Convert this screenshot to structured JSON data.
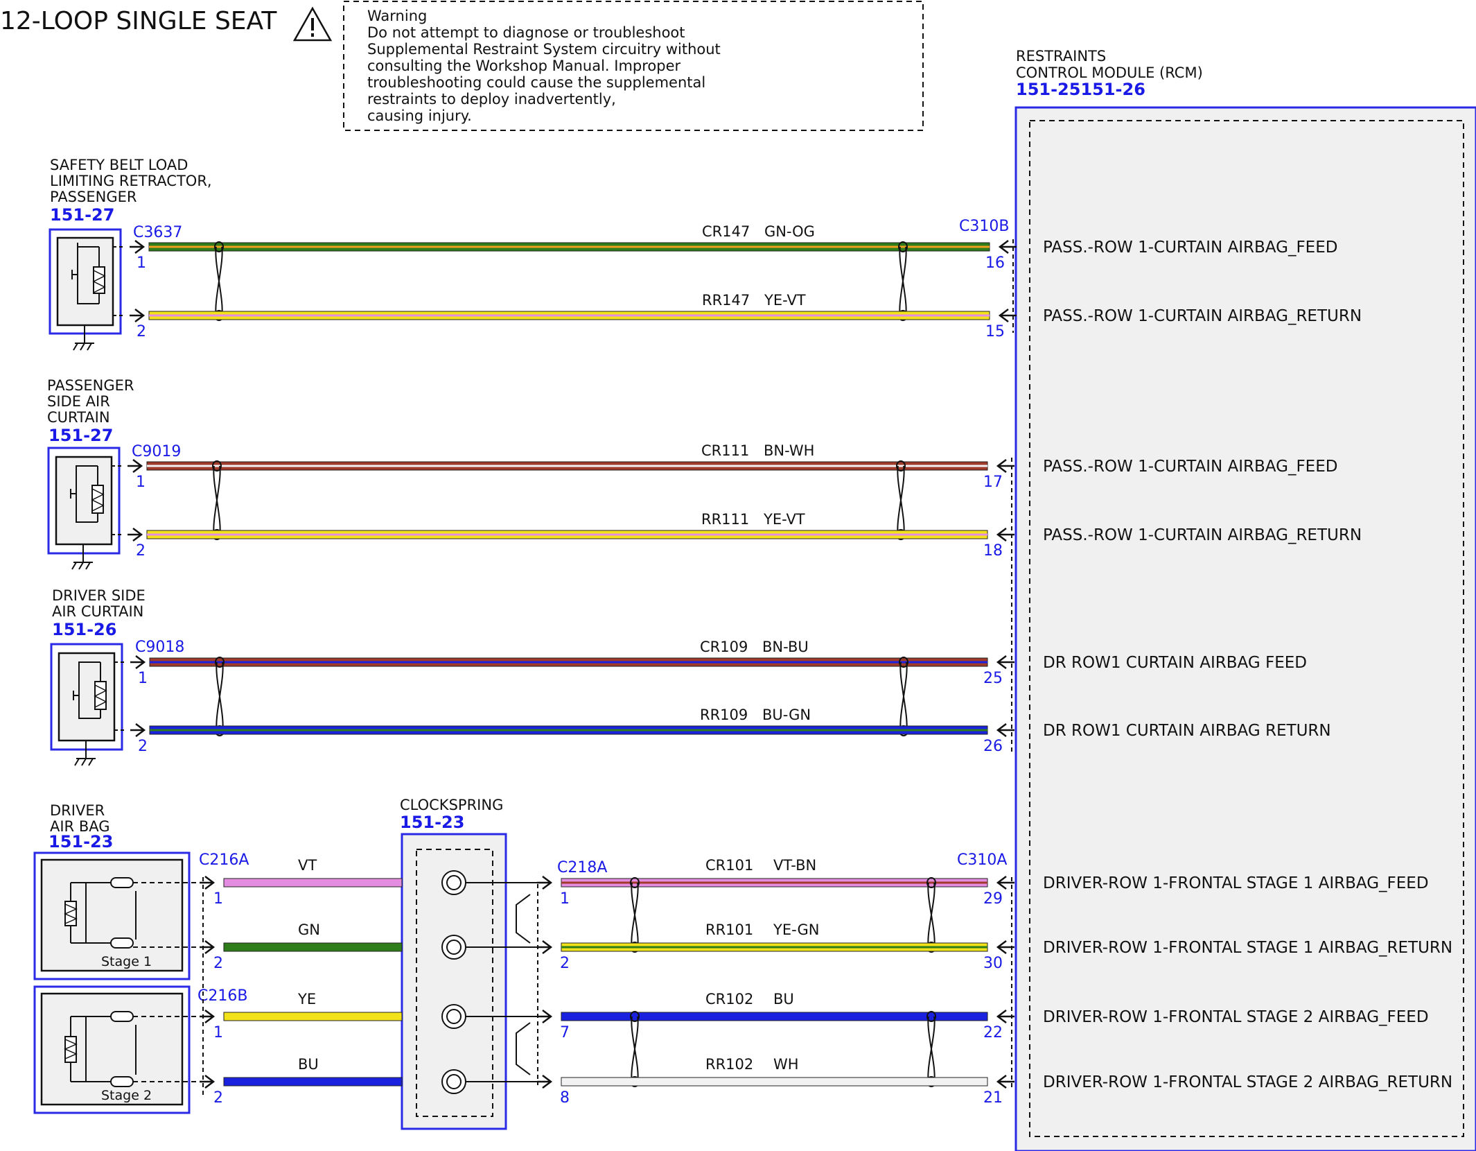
{
  "title": "12-LOOP SINGLE SEAT",
  "warning": {
    "heading": "Warning",
    "lines": [
      "Do not attempt to diagnose or troubleshoot",
      "Supplemental Restraint System circuitry without",
      "consulting the Workshop Manual. Improper",
      "troubleshooting could cause the supplemental",
      "restraints to deploy inadvertently,",
      "causing injury."
    ]
  },
  "rcm": {
    "name_lines": [
      "RESTRAINTS",
      "CONTROL MODULE (RCM)"
    ],
    "ref": "151-25151-26",
    "connector_upper": "C310B",
    "connector_lower": "C310A"
  },
  "components": [
    {
      "name_lines": [
        "SAFETY BELT LOAD",
        "LIMITING RETRACTOR,",
        "PASSENGER"
      ],
      "ref": "151-27",
      "connector": "C3637"
    },
    {
      "name_lines": [
        "PASSENGER",
        "SIDE AIR",
        "CURTAIN"
      ],
      "ref": "151-27",
      "connector": "C9019"
    },
    {
      "name_lines": [
        "DRIVER SIDE",
        "AIR CURTAIN"
      ],
      "ref": "151-26",
      "connector": "C9018"
    }
  ],
  "driver_airbag": {
    "name_lines": [
      "DRIVER",
      "AIR BAG"
    ],
    "ref": "151-23",
    "stage1_label": "Stage 1",
    "stage2_label": "Stage 2",
    "connector_1": "C216A",
    "connector_2": "C216B"
  },
  "clockspring": {
    "name": "CLOCKSPRING",
    "ref": "151-23",
    "connector_out": "C218A"
  },
  "circuits": [
    {
      "circuit": "CR147",
      "color": "GN-OG",
      "pin_left": "1",
      "pin_right": "16",
      "signal": "PASS.-ROW 1-CURTAIN AIRBAG_FEED"
    },
    {
      "circuit": "RR147",
      "color": "YE-VT",
      "pin_left": "2",
      "pin_right": "15",
      "signal": "PASS.-ROW 1-CURTAIN AIRBAG_RETURN"
    },
    {
      "circuit": "CR111",
      "color": "BN-WH",
      "pin_left": "1",
      "pin_right": "17",
      "signal": "PASS.-ROW 1-CURTAIN AIRBAG_FEED"
    },
    {
      "circuit": "RR111",
      "color": "YE-VT",
      "pin_left": "2",
      "pin_right": "18",
      "signal": "PASS.-ROW 1-CURTAIN AIRBAG_RETURN"
    },
    {
      "circuit": "CR109",
      "color": "BN-BU",
      "pin_left": "1",
      "pin_right": "25",
      "signal": "DR ROW1 CURTAIN AIRBAG FEED"
    },
    {
      "circuit": "RR109",
      "color": "BU-GN",
      "pin_left": "2",
      "pin_right": "26",
      "signal": "DR ROW1 CURTAIN AIRBAG RETURN"
    },
    {
      "circuit": "CR101",
      "color": "VT-BN",
      "pin_left": "1",
      "pin_right": "29",
      "signal": "DRIVER-ROW 1-FRONTAL STAGE 1 AIRBAG_FEED",
      "airbag_wire": "VT",
      "airbag_pin": "1"
    },
    {
      "circuit": "RR101",
      "color": "YE-GN",
      "pin_left": "2",
      "pin_right": "30",
      "signal": "DRIVER-ROW 1-FRONTAL STAGE 1 AIRBAG_RETURN",
      "airbag_wire": "GN",
      "airbag_pin": "2"
    },
    {
      "circuit": "CR102",
      "color": "BU",
      "pin_left": "7",
      "pin_right": "22",
      "signal": "DRIVER-ROW 1-FRONTAL STAGE 2 AIRBAG_FEED",
      "airbag_wire": "YE",
      "airbag_pin": "1"
    },
    {
      "circuit": "RR102",
      "color": "WH",
      "pin_left": "8",
      "pin_right": "21",
      "signal": "DRIVER-ROW 1-FRONTAL STAGE 2 AIRBAG_RETURN",
      "airbag_wire": "BU",
      "airbag_pin": "2"
    }
  ],
  "wire_colors": {
    "GN": "#2e7d1a",
    "OG": "#f0a020",
    "YE": "#f2e21a",
    "VT": "#e38ce0",
    "BN": "#a03a2a",
    "WH": "#f2f2f2",
    "BU": "#1a22e0",
    "gray": "#f0f0f0",
    "blue_outline": "#2a2ae6"
  }
}
